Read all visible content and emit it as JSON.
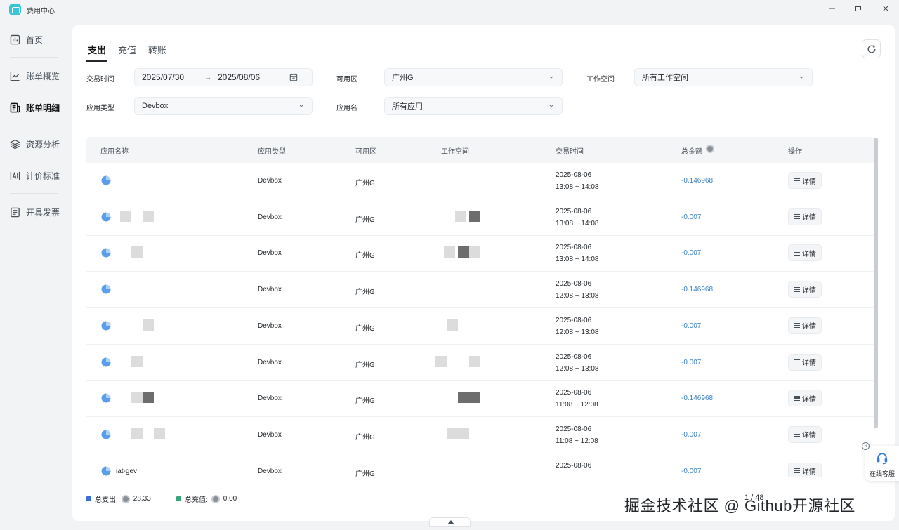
{
  "window": {
    "title": "费用中心"
  },
  "sidebar": {
    "items": [
      {
        "label": "首页",
        "icon": "bar-chart-icon"
      },
      {
        "label": "账单概览",
        "icon": "line-chart-icon"
      },
      {
        "label": "账单明细",
        "icon": "receipt-icon",
        "active": true
      },
      {
        "label": "资源分析",
        "icon": "layers-icon"
      },
      {
        "label": "计价标准",
        "icon": "ai-icon"
      },
      {
        "label": "开具发票",
        "icon": "invoice-icon"
      }
    ]
  },
  "tabs": [
    "支出",
    "充值",
    "转账"
  ],
  "filters": {
    "time_label": "交易时间",
    "start_date": "2025/07/30",
    "arrow": "→",
    "end_date": "2025/08/06",
    "zone_label": "可用区",
    "zone_value": "广州G",
    "workspace_label": "工作空间",
    "workspace_value": "所有工作空间",
    "apptype_label": "应用类型",
    "apptype_value": "Devbox",
    "appname_label": "应用名",
    "appname_value": "所有应用"
  },
  "table": {
    "headers": [
      "应用名称",
      "应用类型",
      "可用区",
      "工作空间",
      "交易时间",
      "总金额",
      "操作"
    ],
    "rows": [
      {
        "name": "",
        "type": "Devbox",
        "zone": "广州G",
        "date": "2025-08-06",
        "range": "13:08 ~ 14:08",
        "amount": "-0.146968"
      },
      {
        "name": "",
        "type": "Devbox",
        "zone": "广州G",
        "date": "2025-08-06",
        "range": "13:08 ~ 14:08",
        "amount": "-0.007"
      },
      {
        "name": "",
        "type": "Devbox",
        "zone": "广州G",
        "date": "2025-08-06",
        "range": "13:08 ~ 14:08",
        "amount": "-0.007"
      },
      {
        "name": "",
        "type": "Devbox",
        "zone": "广州G",
        "date": "2025-08-06",
        "range": "12:08 ~ 13:08",
        "amount": "-0.146968"
      },
      {
        "name": "",
        "type": "Devbox",
        "zone": "广州G",
        "date": "2025-08-06",
        "range": "12:08 ~ 13:08",
        "amount": "-0.007"
      },
      {
        "name": "",
        "type": "Devbox",
        "zone": "广州G",
        "date": "2025-08-06",
        "range": "12:08 ~ 13:08",
        "amount": "-0.007"
      },
      {
        "name": "",
        "type": "Devbox",
        "zone": "广州G",
        "date": "2025-08-06",
        "range": "11:08 ~ 12:08",
        "amount": "-0.146968"
      },
      {
        "name": "",
        "type": "Devbox",
        "zone": "广州G",
        "date": "2025-08-06",
        "range": "11:08 ~ 12:08",
        "amount": "-0.007"
      },
      {
        "name": "iat-gev",
        "type": "Devbox",
        "zone": "广州G",
        "date": "2025-08-06",
        "range": "",
        "amount": "-0.007"
      }
    ],
    "action_label": "详情"
  },
  "footer": {
    "spend_label": "总支出:",
    "spend_value": "28.33",
    "recharge_label": "总充值:",
    "recharge_value": "0.00",
    "spend_color": "#3b6fd4",
    "recharge_color": "#3aa57a"
  },
  "pagination": {
    "text": "1 / 48"
  },
  "watermark": "掘金技术社区 @ Github开源社区",
  "service": {
    "label": "在线客服"
  }
}
